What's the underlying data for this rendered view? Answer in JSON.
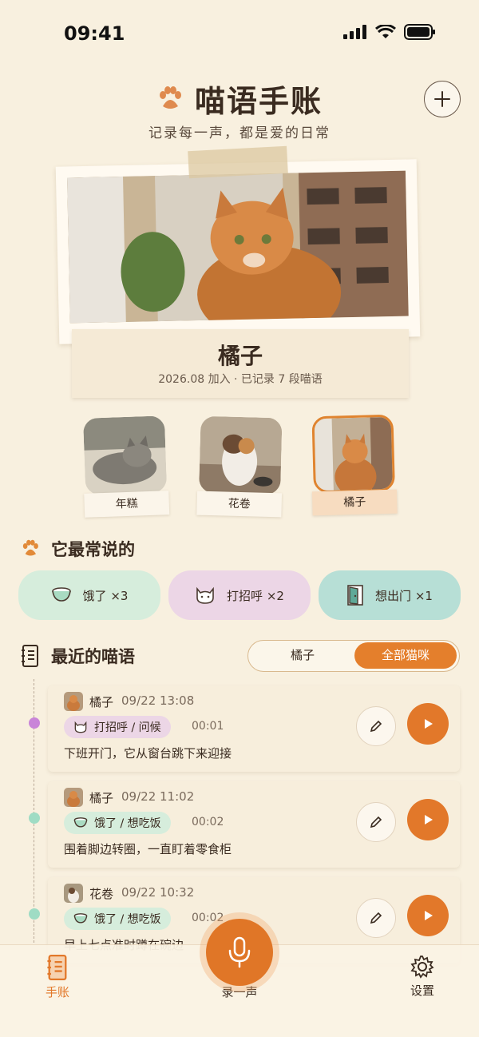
{
  "status": {
    "time": "09:41"
  },
  "header": {
    "title": "喵语手账",
    "subtitle": "记录每一声，都是爱的日常",
    "add_icon": "plus-icon"
  },
  "profile": {
    "name": "橘子",
    "meta": "2026.08 加入 · 已记录 7 段喵语"
  },
  "cats": [
    {
      "label": "年糕",
      "active": false
    },
    {
      "label": "花卷",
      "active": false
    },
    {
      "label": "橘子",
      "active": true
    }
  ],
  "frequent": {
    "title": "它最常说的",
    "chips": [
      {
        "label": "饿了 ×3",
        "icon": "bowl-icon",
        "color": "#d6eddc"
      },
      {
        "label": "打招呼 ×2",
        "icon": "cat-face-icon",
        "color": "#ecd6e6"
      },
      {
        "label": "想出门 ×1",
        "icon": "door-icon",
        "color": "#b7dfd6"
      }
    ]
  },
  "recent": {
    "title": "最近的喵语",
    "filter": {
      "option_a": "橘子",
      "option_b": "全部猫咪",
      "selected": "全部猫咪"
    },
    "entries": [
      {
        "cat": "橘子",
        "time": "09/22 13:08",
        "tag": "打招呼 / 问候",
        "duration": "00:01",
        "text": "下班开门，它从窗台跳下来迎接",
        "dot": "#c985d8"
      },
      {
        "cat": "橘子",
        "time": "09/22 11:02",
        "tag": "饿了 / 想吃饭",
        "duration": "00:02",
        "text": "围着脚边转圈，一直盯着零食柜",
        "dot": "#9fdcc4"
      },
      {
        "cat": "花卷",
        "time": "09/22 10:32",
        "tag": "饿了 / 想吃饭",
        "duration": "00:02",
        "text": "早上七点准时蹲在碗边",
        "dot": "#9fdcc4"
      }
    ]
  },
  "tabbar": {
    "journal": "手账",
    "record": "录一声",
    "settings": "设置"
  },
  "colors": {
    "accent": "#e2782a",
    "background": "#f8f0df"
  }
}
